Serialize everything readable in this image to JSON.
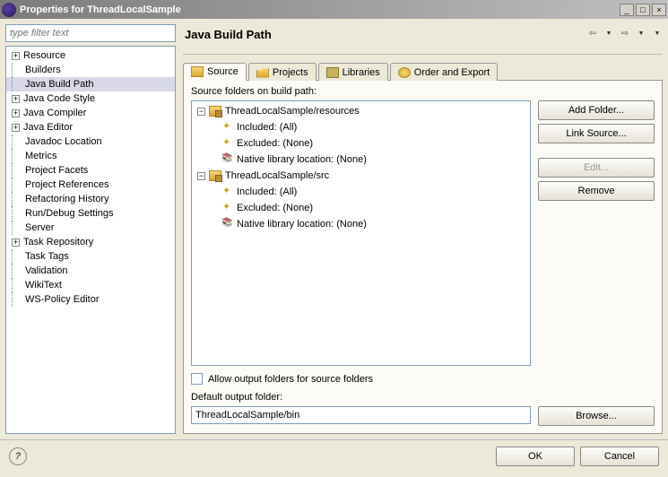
{
  "window": {
    "title": "Properties for ThreadLocalSample"
  },
  "filter_placeholder": "type filter text",
  "nav": [
    {
      "label": "Resource",
      "expand": "+"
    },
    {
      "label": "Builders",
      "expand": ""
    },
    {
      "label": "Java Build Path",
      "expand": "",
      "selected": true
    },
    {
      "label": "Java Code Style",
      "expand": "+"
    },
    {
      "label": "Java Compiler",
      "expand": "+"
    },
    {
      "label": "Java Editor",
      "expand": "+"
    },
    {
      "label": "Javadoc Location",
      "expand": ""
    },
    {
      "label": "Metrics",
      "expand": ""
    },
    {
      "label": "Project Facets",
      "expand": ""
    },
    {
      "label": "Project References",
      "expand": ""
    },
    {
      "label": "Refactoring History",
      "expand": ""
    },
    {
      "label": "Run/Debug Settings",
      "expand": ""
    },
    {
      "label": "Server",
      "expand": ""
    },
    {
      "label": "Task Repository",
      "expand": "+"
    },
    {
      "label": "Task Tags",
      "expand": ""
    },
    {
      "label": "Validation",
      "expand": ""
    },
    {
      "label": "WikiText",
      "expand": ""
    },
    {
      "label": "WS-Policy Editor",
      "expand": ""
    }
  ],
  "heading": "Java Build Path",
  "tabs": {
    "source": "Source",
    "projects": "Projects",
    "libraries": "Libraries",
    "order": "Order and Export"
  },
  "source_panel": {
    "label": "Source folders on build path:",
    "folders": [
      {
        "path": "ThreadLocalSample/resources",
        "included": "Included: (All)",
        "excluded": "Excluded: (None)",
        "native": "Native library location: (None)"
      },
      {
        "path": "ThreadLocalSample/src",
        "included": "Included: (All)",
        "excluded": "Excluded: (None)",
        "native": "Native library location: (None)"
      }
    ],
    "buttons": {
      "add_folder": "Add Folder...",
      "link_source": "Link Source...",
      "edit": "Edit...",
      "remove": "Remove"
    },
    "allow_output": "Allow output folders for source folders",
    "default_out_label": "Default output folder:",
    "default_out_value": "ThreadLocalSample/bin",
    "browse": "Browse..."
  },
  "bottom": {
    "ok": "OK",
    "cancel": "Cancel"
  }
}
